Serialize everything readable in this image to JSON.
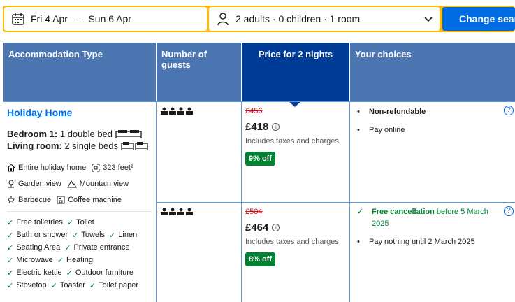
{
  "search": {
    "dates": "Fri 4 Apr  —  Sun 6 Apr",
    "guests": "2 adults · 0 children · 1 room",
    "button": "Change search"
  },
  "table": {
    "headers": {
      "type": "Accommodation Type",
      "guests": "Number of guests",
      "price": "Price for 2 nights",
      "choices": "Your choices"
    }
  },
  "room": {
    "title": "Holiday Home",
    "beds": [
      {
        "label": "Bedroom 1:",
        "value": "1 double bed"
      },
      {
        "label": "Living room:",
        "value": "2 single beds"
      }
    ],
    "facilities": [
      [
        "Entire holiday home",
        "323 feet²"
      ],
      [
        "Garden view",
        "Mountain view"
      ],
      [
        "Barbecue",
        "Coffee machine"
      ]
    ],
    "amenities": [
      [
        "Free toiletries",
        "Toilet"
      ],
      [
        "Bath or shower",
        "Towels",
        "Linen"
      ],
      [
        "Seating Area",
        "Private entrance"
      ],
      [
        "Microwave",
        "Heating"
      ],
      [
        "Electric kettle",
        "Outdoor furniture"
      ],
      [
        "Stovetop",
        "Toaster",
        "Toilet paper"
      ]
    ]
  },
  "options": [
    {
      "guests": 4,
      "old_price": "£456",
      "price": "£418",
      "tax_note": "Includes taxes and charges",
      "discount": "9% off",
      "choices": [
        {
          "text": "Non-refundable",
          "bold": true
        },
        {
          "text": "Pay online"
        }
      ]
    },
    {
      "guests": 4,
      "old_price": "£504",
      "price": "£464",
      "tax_note": "Includes taxes and charges",
      "discount": "8% off",
      "choices": [
        {
          "text": "Free cancellation",
          "suffix": " before 5 March 2025",
          "green": true
        },
        {
          "text": "Pay nothing until 2 March 2025"
        }
      ]
    }
  ],
  "colors": {
    "brand_yellow": "#febb02",
    "brand_blue": "#006ce4",
    "header_blue": "#4c76b2",
    "header_dark": "#003b95",
    "success_green": "#008234",
    "strike_red": "#d4111e"
  }
}
